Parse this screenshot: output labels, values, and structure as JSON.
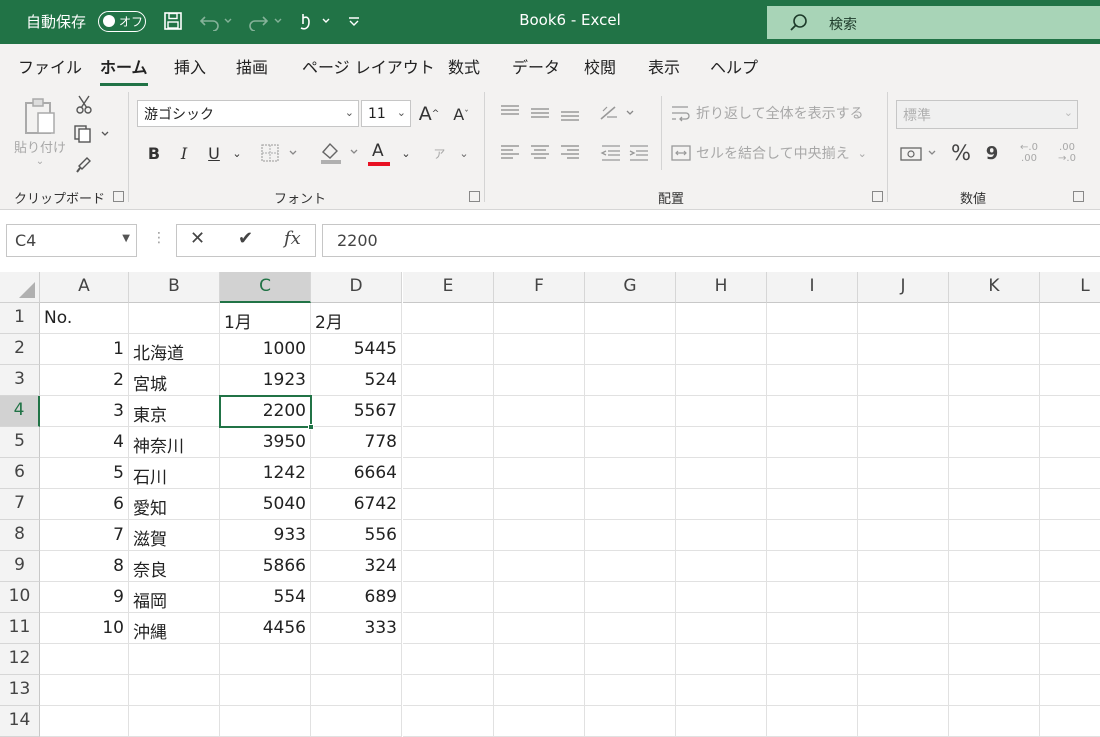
{
  "titlebar": {
    "autosave_label": "自動保存",
    "autosave_state": "オフ",
    "document_title": "Book6  -  Excel",
    "search_placeholder": "検索",
    "accent_color": "#217346"
  },
  "menu": {
    "tabs": [
      "ファイル",
      "ホーム",
      "挿入",
      "描画",
      "ページ レイアウト",
      "数式",
      "データ",
      "校閲",
      "表示",
      "ヘルプ"
    ],
    "active_tab": "ホーム"
  },
  "ribbon": {
    "clipboard": {
      "paste_label": "貼り付け",
      "group_label": "クリップボード"
    },
    "font": {
      "font_name": "游ゴシック",
      "font_size": "11",
      "bold": "B",
      "italic": "I",
      "underline": "U",
      "font_color_letter": "A",
      "grow": "A",
      "shrink": "A",
      "phonetic": "ア",
      "group_label": "フォント"
    },
    "alignment": {
      "wrap_text": "折り返して全体を表示する",
      "merge_center": "セルを結合して中央揃え",
      "group_label": "配置"
    },
    "number": {
      "format": "標準",
      "percent": "%",
      "comma": "9",
      "increase_decimal": "←.0 .00",
      "decrease_decimal": ".00 →.0",
      "group_label": "数値"
    }
  },
  "formula_bar": {
    "name_box": "C4",
    "cancel_symbol": "✕",
    "enter_symbol": "✔",
    "fx_symbol": "fx",
    "value": "2200"
  },
  "sheet": {
    "columns": [
      "A",
      "B",
      "C",
      "D",
      "E",
      "F",
      "G",
      "H",
      "I",
      "J",
      "K",
      "L"
    ],
    "rows": [
      "1",
      "2",
      "3",
      "4",
      "5",
      "6",
      "7",
      "8",
      "9",
      "10",
      "11",
      "12",
      "13",
      "14"
    ],
    "selected_cell": "C4",
    "data": [
      [
        "No.",
        "",
        "1月",
        "2月"
      ],
      [
        "1",
        "北海道",
        "1000",
        "5445"
      ],
      [
        "2",
        "宮城",
        "1923",
        "524"
      ],
      [
        "3",
        "東京",
        "2200",
        "5567"
      ],
      [
        "4",
        "神奈川",
        "3950",
        "778"
      ],
      [
        "5",
        "石川",
        "1242",
        "6664"
      ],
      [
        "6",
        "愛知",
        "5040",
        "6742"
      ],
      [
        "7",
        "滋賀",
        "933",
        "556"
      ],
      [
        "8",
        "奈良",
        "5866",
        "324"
      ],
      [
        "9",
        "福岡",
        "554",
        "689"
      ],
      [
        "10",
        "沖縄",
        "4456",
        "333"
      ]
    ]
  }
}
